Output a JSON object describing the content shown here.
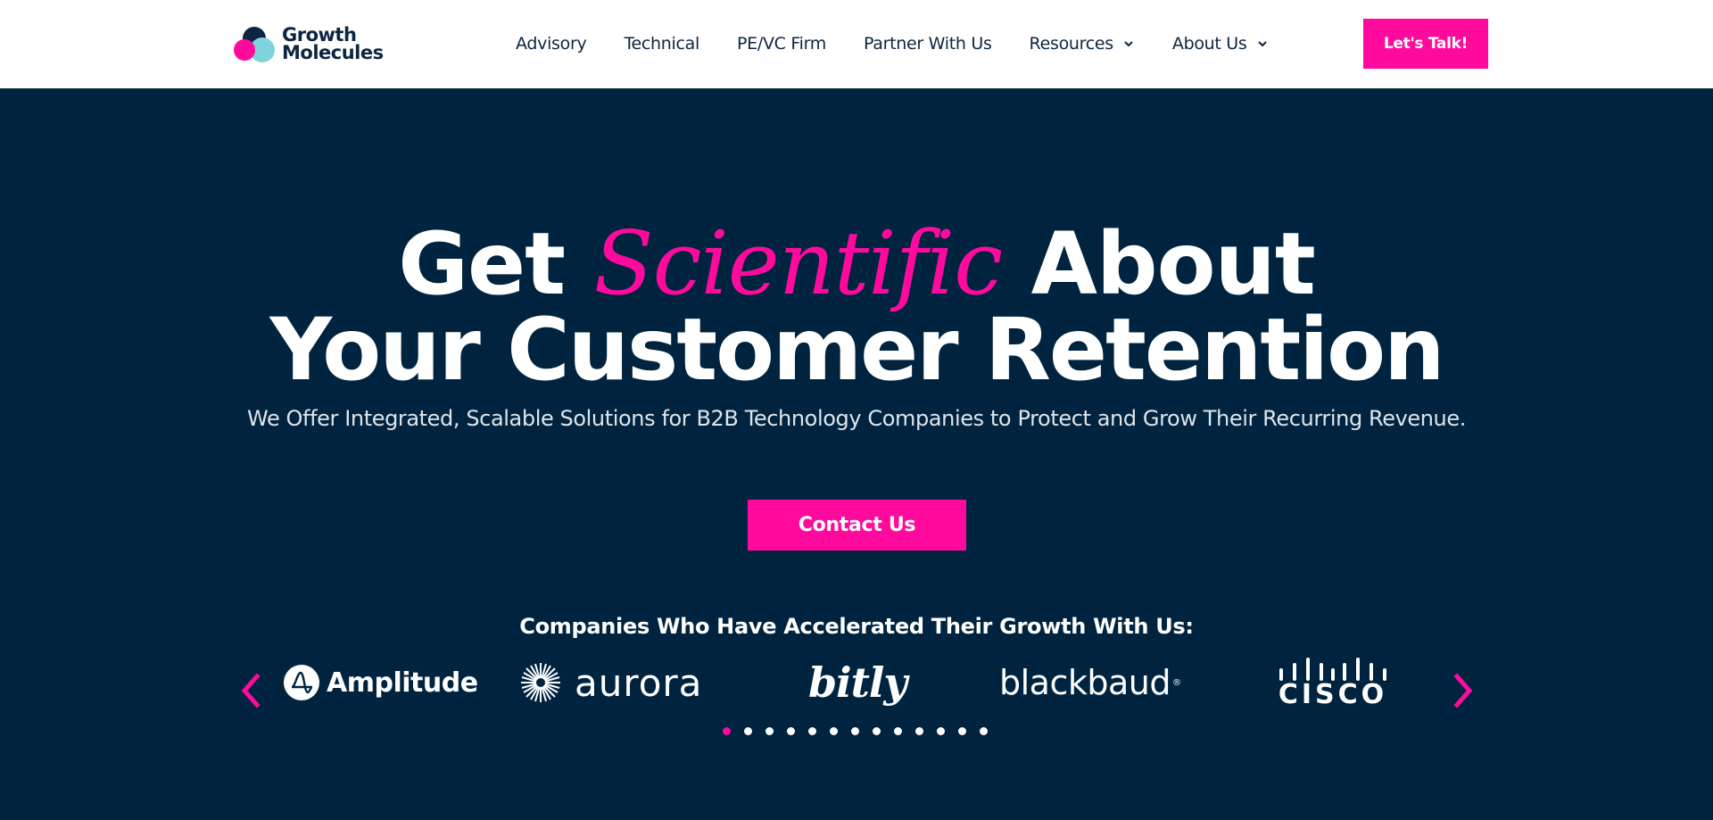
{
  "logo": {
    "line1": "Growth",
    "line2": "Molecules"
  },
  "nav": {
    "items": [
      {
        "label": "Advisory"
      },
      {
        "label": "Technical"
      },
      {
        "label": "PE/VC Firm"
      },
      {
        "label": "Partner With Us"
      },
      {
        "label": "Resources",
        "dropdown": true
      },
      {
        "label": "About Us",
        "dropdown": true
      }
    ],
    "cta_label": "Let's Talk!"
  },
  "hero": {
    "line1_start": "Get",
    "line1_accent": "Scientific",
    "line1_end": "About",
    "line2": "Your Customer Retention",
    "subtitle": "We Offer Integrated, Scalable Solutions for B2B Technology Companies to Protect and Grow Their Recurring Revenue.",
    "cta_label": "Contact Us"
  },
  "companies": {
    "title": "Companies Who Have Accelerated Their Growth With Us:",
    "logos": [
      {
        "name": "Amplitude"
      },
      {
        "name": "aurora"
      },
      {
        "name": "bitly"
      },
      {
        "name": "blackbaud"
      },
      {
        "name": "CISCO"
      }
    ],
    "carousel": {
      "total_pages": 13,
      "active_page": 1
    }
  },
  "colors": {
    "accent": "#ff0a9c",
    "background": "#00243f",
    "header_bg": "#ffffff",
    "nav_text": "#0d2540"
  },
  "icons": {
    "prev": "chevron-left-icon",
    "next": "chevron-right-icon",
    "dropdown": "chevron-down-icon"
  }
}
